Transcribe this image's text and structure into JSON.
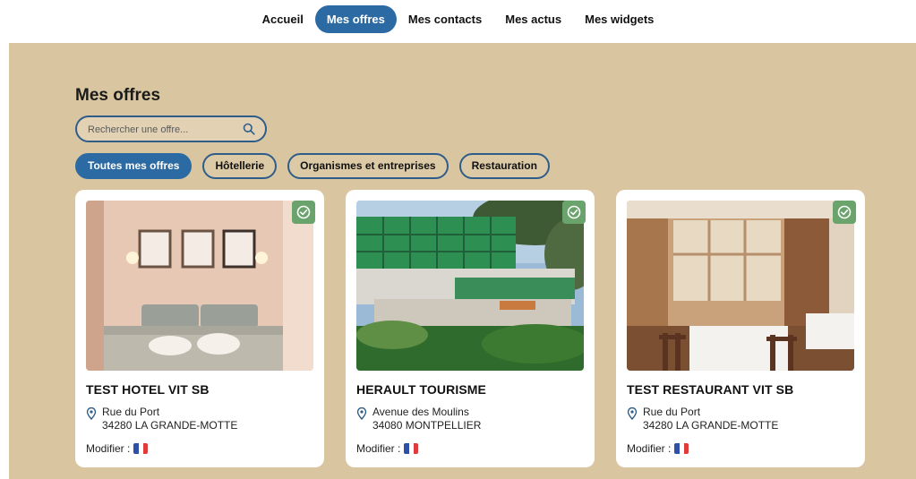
{
  "nav": {
    "items": [
      {
        "label": "Accueil",
        "active": false
      },
      {
        "label": "Mes offres",
        "active": true
      },
      {
        "label": "Mes contacts",
        "active": false
      },
      {
        "label": "Mes actus",
        "active": false
      },
      {
        "label": "Mes widgets",
        "active": false
      }
    ]
  },
  "main": {
    "title": "Mes offres",
    "search": {
      "placeholder": "Rechercher une offre...",
      "value": ""
    },
    "filters": [
      {
        "label": "Toutes mes offres",
        "active": true
      },
      {
        "label": "Hôtellerie",
        "active": false
      },
      {
        "label": "Organismes et entreprises",
        "active": false
      },
      {
        "label": "Restauration",
        "active": false
      }
    ],
    "cards": [
      {
        "title": "TEST HOTEL VIT SB",
        "address_line1": "Rue du Port",
        "address_line2": "34280 LA GRANDE-MOTTE",
        "modify_label": "Modifier :",
        "image": "hotel-bedroom-photo"
      },
      {
        "title": "HERAULT TOURISME",
        "address_line1": "Avenue des Moulins",
        "address_line2": "34080 MONTPELLIER",
        "modify_label": "Modifier :",
        "image": "office-building-photo"
      },
      {
        "title": "TEST RESTAURANT VIT SB",
        "address_line1": "Rue du Port",
        "address_line2": "34280 LA GRANDE-MOTTE",
        "modify_label": "Modifier :",
        "image": "restaurant-interior-photo"
      }
    ]
  },
  "colors": {
    "accent": "#2c6aa3",
    "panel": "#d9c6a1",
    "check_badge": "#6aa36b"
  },
  "icons": [
    "search-icon",
    "check-circle-icon",
    "map-pin-icon",
    "french-flag-icon"
  ]
}
